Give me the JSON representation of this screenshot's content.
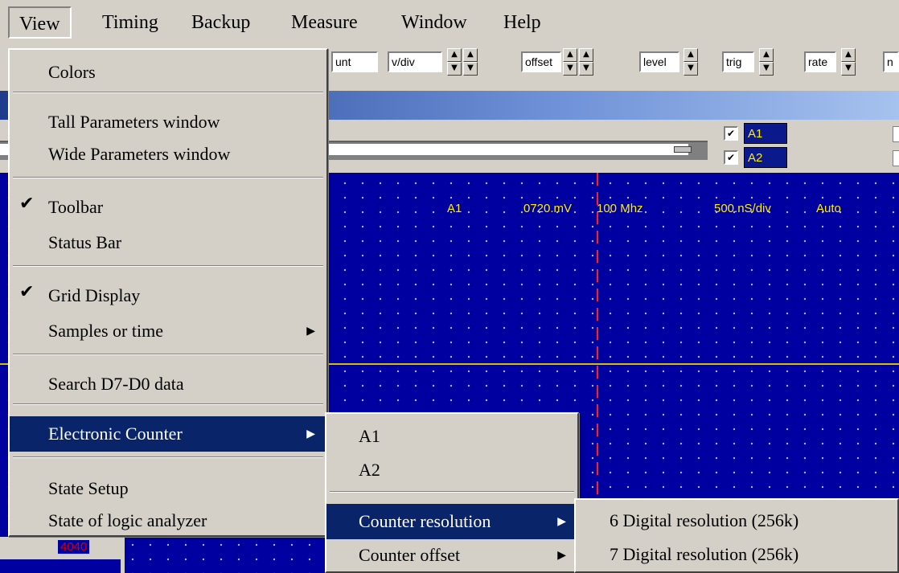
{
  "menubar": {
    "items": [
      {
        "label": "View"
      },
      {
        "label": "Timing"
      },
      {
        "label": "Backup"
      },
      {
        "label": "Measure"
      },
      {
        "label": "Window"
      },
      {
        "label": "Help"
      }
    ]
  },
  "toolbar": {
    "fields": [
      "unt",
      "v/div",
      "offset",
      "level",
      "trig",
      "rate",
      "n"
    ],
    "spin_up": "▲",
    "spin_down": "▼"
  },
  "channels": {
    "a1": "A1",
    "a2": "A2",
    "check": "✔"
  },
  "scope": {
    "channel": "A1",
    "volts": "0720.mV",
    "bandwidth": "100 Mhz",
    "timebase": "500.nS/div",
    "mode": "Auto"
  },
  "status": {
    "value": "4040"
  },
  "view_menu": {
    "items": [
      {
        "label": "Colors",
        "checked": false
      },
      {
        "label": "Tall Parameters window",
        "checked": false
      },
      {
        "label": "Wide Parameters window",
        "checked": false
      },
      {
        "label": "Toolbar",
        "checked": true
      },
      {
        "label": "Status Bar",
        "checked": false
      },
      {
        "label": "Grid Display",
        "checked": true
      },
      {
        "label": "Samples or time",
        "checked": false,
        "submenu": true
      },
      {
        "label": "Search D7-D0 data",
        "checked": false
      },
      {
        "label": "Electronic  Counter",
        "checked": false,
        "submenu": true,
        "selected": true
      },
      {
        "label": "State Setup",
        "checked": false
      },
      {
        "label": "State of logic analyzer",
        "checked": false
      }
    ],
    "check_glyph": "✔",
    "arrow_glyph": "▶"
  },
  "counter_menu": {
    "items": [
      {
        "label": "A1"
      },
      {
        "label": "A2"
      },
      {
        "label": "Counter resolution",
        "submenu": true,
        "selected": true
      },
      {
        "label": "Counter offset",
        "submenu": true
      }
    ]
  },
  "resolution_menu": {
    "items": [
      {
        "label": "6 Digital resolution (256k)"
      },
      {
        "label": "7 Digital resolution (256k)"
      }
    ]
  }
}
